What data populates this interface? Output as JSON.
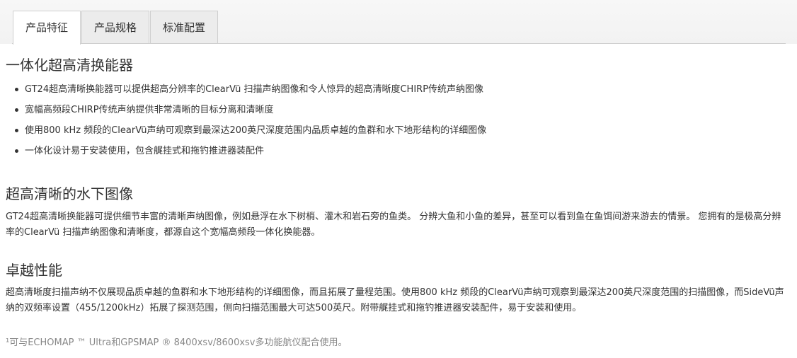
{
  "tabs": [
    {
      "label": "产品特征",
      "active": true
    },
    {
      "label": "产品规格",
      "active": false
    },
    {
      "label": "标准配置",
      "active": false
    }
  ],
  "section1": {
    "heading": "一体化超高清换能器",
    "items": [
      "GT24超高清晰换能器可以提供超高分辨率的ClearVü 扫描声纳图像和令人惊异的超高清晰度CHIRP传统声纳图像",
      "宽幅高频段CHIRP传统声纳提供非常清晰的目标分离和清晰度",
      "使用800 kHz 频段的ClearVü声纳可观察到最深达200英尺深度范围内品质卓越的鱼群和水下地形结构的详细图像",
      "一体化设计易于安装使用，包含艉挂式和拖钓推进器装配件"
    ]
  },
  "section2": {
    "heading": "超高清晰的水下图像",
    "body": "GT24超高清晰换能器可提供细节丰富的清晰声纳图像，例如悬浮在水下树梢、灌木和岩石旁的鱼类。 分辨大鱼和小鱼的差异，甚至可以看到鱼在鱼饵间游来游去的情景。 您拥有的是极高分辨率的ClearVü 扫描声纳图像和清晰度，都源自这个宽幅高频段一体化换能器。"
  },
  "section3": {
    "heading": "卓越性能",
    "body": "超高清晰度扫描声纳不仅展现品质卓越的鱼群和水下地形结构的详细图像，而且拓展了量程范围。使用800 kHz 频段的ClearVü声纳可观察到最深达200英尺深度范围的扫描图像，而SideVü声纳的双频率设置（455/1200kHz）拓展了探测范围，侧向扫描范围最大可达500英尺。附带艉挂式和拖钓推进器安装配件，易于安装和使用。"
  },
  "footnote": "¹可与ECHOMAP ™ Ultra和GPSMAP ® 8400xsv/8600xsv多功能航仪配合使用。"
}
